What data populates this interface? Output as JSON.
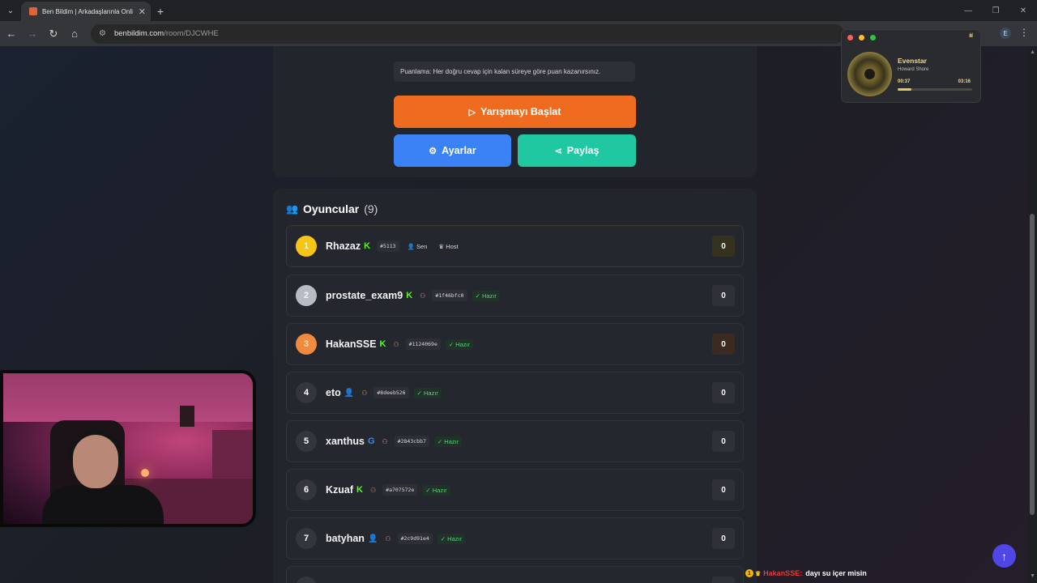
{
  "browser": {
    "tab_title": "Ben Bildim | Arkadaşlarınla Onli",
    "url_host": "benbildim.com",
    "url_path": "/room/DJCWHE",
    "profile_initial": "E"
  },
  "room": {
    "scoring_text": "Puanlama: Her doğru cevap için kalan süreye göre puan kazanırsınız.",
    "start_label": "Yarışmayı Başlat",
    "settings_label": "Ayarlar",
    "share_label": "Paylaş",
    "players_title": "Oyuncular",
    "players_count": "(9)"
  },
  "players": [
    {
      "rank": "1",
      "name": "Rhazaz",
      "provider": "kick",
      "code": "#5113",
      "you": "Sen",
      "host": "Host",
      "score": "0"
    },
    {
      "rank": "2",
      "name": "prostate_exam9",
      "provider": "kick",
      "code": "#1f46bfc0",
      "status": "Hazır",
      "score": "0"
    },
    {
      "rank": "3",
      "name": "HakanSSE",
      "provider": "kick",
      "code": "#1124069e",
      "status": "Hazır",
      "score": "0"
    },
    {
      "rank": "4",
      "name": "eto",
      "provider": "guest",
      "code": "#8deeb526",
      "status": "Hazır",
      "score": "0"
    },
    {
      "rank": "5",
      "name": "xanthus",
      "provider": "google",
      "code": "#2843cbb7",
      "status": "Hazır",
      "score": "0"
    },
    {
      "rank": "6",
      "name": "Kzuaf",
      "provider": "kick",
      "code": "#a707572e",
      "status": "Hazır",
      "score": "0"
    },
    {
      "rank": "7",
      "name": "batyhan",
      "provider": "guest",
      "code": "#2c9d91e4",
      "status": "Hazır",
      "score": "0"
    }
  ],
  "music": {
    "title": "Evenstar",
    "artist": "Howard Shore",
    "elapsed": "00:37",
    "duration": "03:16",
    "progress": 0.19,
    "accent": "#e3c86a"
  },
  "chat": {
    "badge": "1",
    "user": "HakanSSE:",
    "message": "dayı su içer misin"
  },
  "colors": {
    "start": "#ef6b20",
    "settings": "#3b82f6",
    "share": "#1fc8a0",
    "kick": "#53fc18",
    "fab": "#4f46e5"
  },
  "icons": {
    "scroll_top": "arrow-up-icon",
    "players": "users-icon"
  }
}
